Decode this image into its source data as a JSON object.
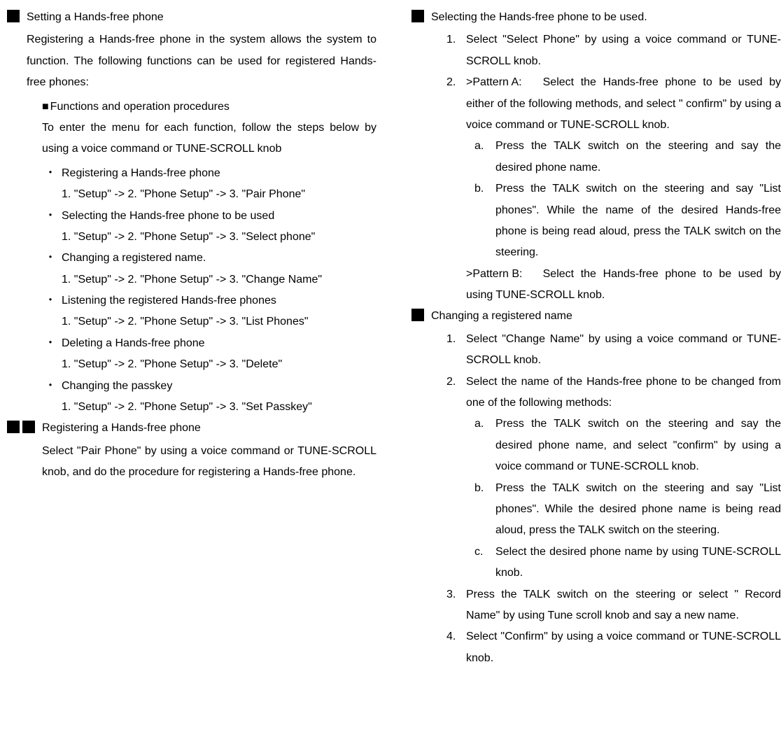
{
  "left": {
    "section1": {
      "title": "Setting a Hands-free phone",
      "body": "Registering a Hands-free phone in the system allows the system to function. The following functions can be used for registered Hands-free phones:",
      "subheading": "Functions and operation procedures",
      "subbody": "To enter the menu for each function, follow the steps below by using a voice command or TUNE-SCROLL knob",
      "bullets": [
        {
          "label": "Registering a Hands-free phone",
          "path": "1. \"Setup\" -> 2. \"Phone Setup\" -> 3. \"Pair Phone\""
        },
        {
          "label": "Selecting the Hands-free phone to be used",
          "path": "1. \"Setup\" -> 2. \"Phone Setup\" -> 3. \"Select phone\""
        },
        {
          "label": "Changing a registered name.",
          "path": "1. \"Setup\" -> 2. \"Phone Setup\" -> 3. \"Change Name\""
        },
        {
          "label": "Listening the registered Hands-free phones",
          "path": "1. \"Setup\" -> 2. \"Phone Setup\" -> 3. \"List Phones\""
        },
        {
          "label": "Deleting a Hands-free phone",
          "path": "1. \"Setup\" -> 2. \"Phone Setup\" -> 3. \"Delete\""
        },
        {
          "label": "Changing the passkey",
          "path": "1. \"Setup\" -> 2. \"Phone Setup\" -> 3. \"Set Passkey\""
        }
      ]
    },
    "section2": {
      "title": "Registering a Hands-free phone",
      "body": "Select \"Pair Phone\" by using a voice command or TUNE-SCROLL knob, and do the procedure for registering a Hands-free phone."
    }
  },
  "right": {
    "section1": {
      "title": "Selecting the Hands-free phone to be used.",
      "step1num": "1.",
      "step1": "Select \"Select Phone\" by using a voice command or TUNE-SCROLL knob.",
      "step2num": "2.",
      "step2prefix": ">Pattern A:",
      "step2": "Select the Hands-free phone to be used by either of the following methods, and select \" confirm\" by using a voice command or TUNE-SCROLL knob.",
      "step2aletter": "a.",
      "step2a": "Press the TALK switch on the steering and say the desired phone name.",
      "step2bletter": "b.",
      "step2b": "Press the TALK switch on the steering and say \"List phones\". While the name of the desired Hands-free phone is being read aloud, press the TALK switch on the steering.",
      "patternBprefix": ">Pattern B:",
      "patternB": "Select the Hands-free phone to be used by using TUNE-SCROLL knob."
    },
    "section2": {
      "title": "Changing a registered name",
      "step1num": "1.",
      "step1": "Select \"Change Name\" by using a voice command or TUNE-SCROLL knob.",
      "step2num": "2.",
      "step2": "Select the name of the Hands-free phone to be changed from one of the following methods:",
      "step2aletter": "a.",
      "step2a": "Press the TALK switch on the steering and say the desired phone name, and select \"confirm\" by using a voice command or TUNE-SCROLL knob.",
      "step2bletter": "b.",
      "step2b": "Press the TALK switch on the steering and say \"List phones\". While the desired phone name is being read aloud, press the TALK switch on the steering.",
      "step2cletter": "c.",
      "step2c": "Select the desired phone name by using TUNE-SCROLL knob.",
      "step3num": "3.",
      "step3": "Press the TALK switch on the steering or select \" Record Name\" by using Tune scroll knob and say a new name.",
      "step4num": "4.",
      "step4": "Select \"Confirm\" by using a voice command or TUNE-SCROLL knob."
    }
  }
}
